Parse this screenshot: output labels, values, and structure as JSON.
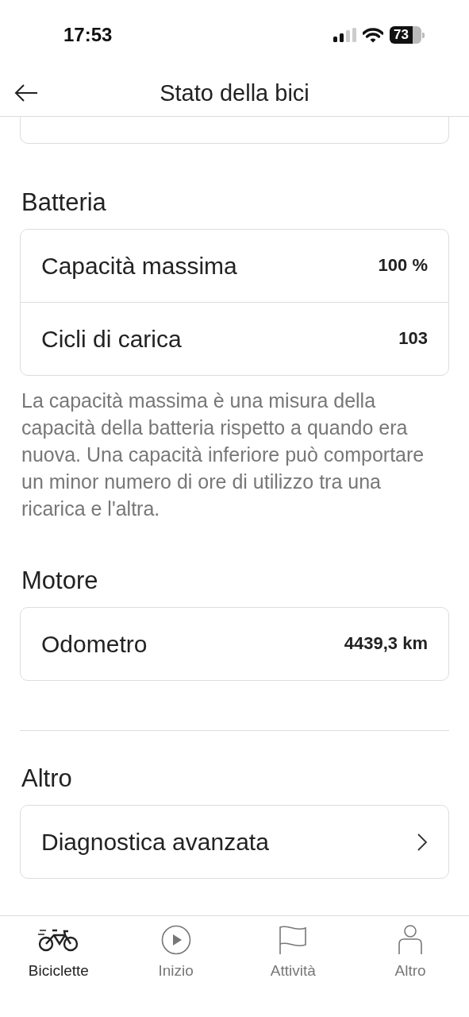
{
  "status_bar": {
    "time": "17:53",
    "battery": "73"
  },
  "header": {
    "title": "Stato della bici"
  },
  "sections": [
    {
      "title": "Batteria",
      "rows": [
        {
          "kind": "value",
          "label": "Capacità massima",
          "value": "100 %"
        },
        {
          "kind": "value",
          "label": "Cicli di carica",
          "value": "103"
        }
      ],
      "note": "La capacità massima è una misura della capacità della batteria rispetto a quando era nuova. Una capacità inferiore può comportare un minor numero di ore di utilizzo tra una ricarica e l'altra."
    },
    {
      "title": "Motore",
      "rows": [
        {
          "kind": "value",
          "label": "Odometro",
          "value": "4439,3 km"
        }
      ]
    },
    {
      "title": "Altro",
      "divider_before": true,
      "rows": [
        {
          "kind": "link",
          "label": "Diagnostica avanzata"
        }
      ]
    }
  ],
  "tabs": [
    {
      "label": "Biciclette",
      "selected": true
    },
    {
      "label": "Inizio",
      "selected": false
    },
    {
      "label": "Attività",
      "selected": false
    },
    {
      "label": "Altro",
      "selected": false
    }
  ]
}
